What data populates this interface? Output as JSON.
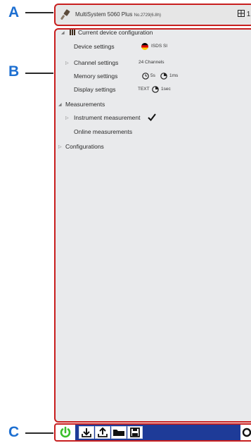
{
  "callouts": {
    "a": "A",
    "b": "B",
    "c": "C"
  },
  "header": {
    "title": "MultiSystem 5060 Plus",
    "subtitle": "No.2729(6.8h)",
    "right_text": "1"
  },
  "tree": {
    "section_device": "Current device configuration",
    "items": [
      {
        "label": "Device settings",
        "value": "ISDS SI"
      },
      {
        "label": "Channel settings",
        "value": "24 Channels"
      },
      {
        "label": "Memory settings",
        "value_a": "5s",
        "value_b": "1ms"
      },
      {
        "label": "Display settings",
        "value_a": "TEXT",
        "value_b": "1sec"
      }
    ],
    "section_measurements": "Measurements",
    "instrument_measurement": "Instrument measurement",
    "online_measurements": "Online measurements",
    "configurations": "Configurations"
  },
  "colors": {
    "frame": "#c81e1e",
    "callout": "#1d6fd1",
    "toolbar": "#1e3b98",
    "power": "#3bbf2b"
  },
  "icons": [
    "probe-icon",
    "grid-icon",
    "flag-icon",
    "clock-icon",
    "pie-icon",
    "check-icon",
    "power-icon",
    "download-icon",
    "upload-icon",
    "folder-icon",
    "save-icon",
    "circle-icon"
  ]
}
